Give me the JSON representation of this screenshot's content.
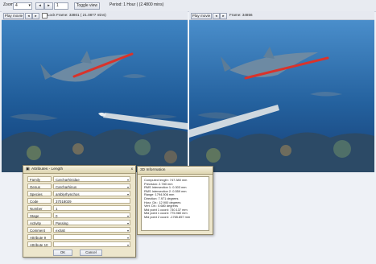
{
  "toolbar": {
    "zoom_label": "Zoom",
    "zoom_value": "4",
    "frame_step_value": "1",
    "toggle_label": "Toggle view",
    "period_text": "Period: 1 Hour ( (2.4800 mins)"
  },
  "left_panel": {
    "play_label": "Play movie",
    "lock_label": "Lock",
    "frame_text": "Frame: 33801 ( 21.0877 mins)"
  },
  "right_panel": {
    "play_label": "Play movie",
    "frame_text": "Frame: 34856"
  },
  "attributes_dialog": {
    "title": "Attributes - Length",
    "close_icon_text": "x",
    "rows": [
      {
        "label": "Family",
        "value": "Carcharhinidae",
        "dropdown": true
      },
      {
        "label": "Genus",
        "value": "Carcharhinus",
        "dropdown": true
      },
      {
        "label": "Species",
        "value": "amblyrhynchos",
        "dropdown": true
      },
      {
        "label": "Code",
        "value": "37018029",
        "dropdown": false
      },
      {
        "label": "Number",
        "value": "1",
        "dropdown": false
      },
      {
        "label": "Stage",
        "value": "0",
        "dropdown": true
      },
      {
        "label": "Activity",
        "value": "Passing",
        "dropdown": true
      },
      {
        "label": "Comment",
        "value": "ext/alt",
        "dropdown": true
      },
      {
        "label": "Attribute 9",
        "value": "",
        "dropdown": true
      },
      {
        "label": "Attribute 10",
        "value": "",
        "dropdown": true
      }
    ],
    "ok_label": "OK",
    "cancel_label": "Cancel"
  },
  "info_dialog": {
    "title": "3D Information",
    "lines": [
      "Computed length: 747.380 mm",
      "Precision: 2.780 mm",
      "RMS Intersection 1: 0.303 mm",
      "RMS Intersection 2: 0.559 mm",
      "Range: 1794.506 mm",
      "Direction: 7.971 degrees",
      "Horz. Dir.: 12.900 degrees",
      "Vert. Dir.: 0.680 degrees",
      "Mid point 1 coord: 730.137 mm",
      "Mid point 1 coord: 775.980 mm",
      "Mid point 2 coord: -1765.857 mm"
    ]
  },
  "colors": {
    "water_dark": "#123f78",
    "water_light": "#3f84c2",
    "measure_line": "#d9332b"
  }
}
